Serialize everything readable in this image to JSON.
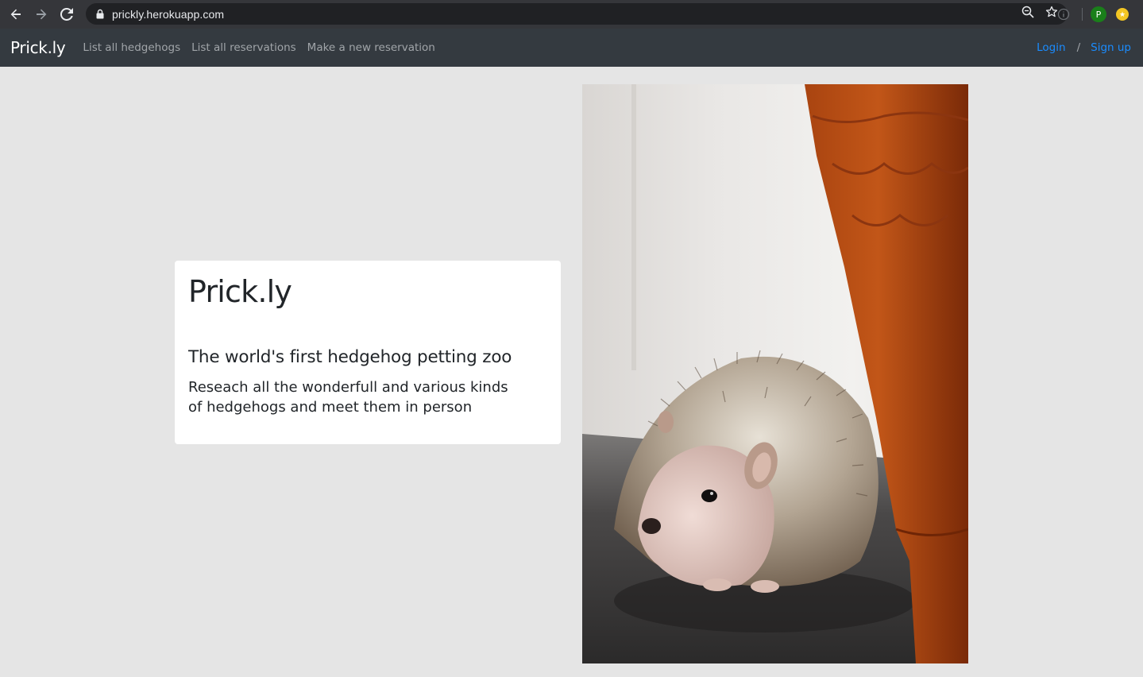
{
  "browser": {
    "url": "prickly.herokuapp.com",
    "profile_initial": "P"
  },
  "navbar": {
    "brand": "Prick.ly",
    "links": [
      {
        "label": "List all hedgehogs"
      },
      {
        "label": "List all reservations"
      },
      {
        "label": "Make a new reservation"
      }
    ],
    "login_label": "Login",
    "separator": "/",
    "signup_label": "Sign up"
  },
  "hero": {
    "title": "Prick.ly",
    "subtitle": "The world's first hedgehog petting zoo",
    "description": "Reseach all the wonderfull and various kinds of hedgehogs and meet them in person"
  },
  "colors": {
    "navbar_bg": "#343a40",
    "link_accent": "#1a8cff",
    "page_bg": "#e5e5e5"
  }
}
